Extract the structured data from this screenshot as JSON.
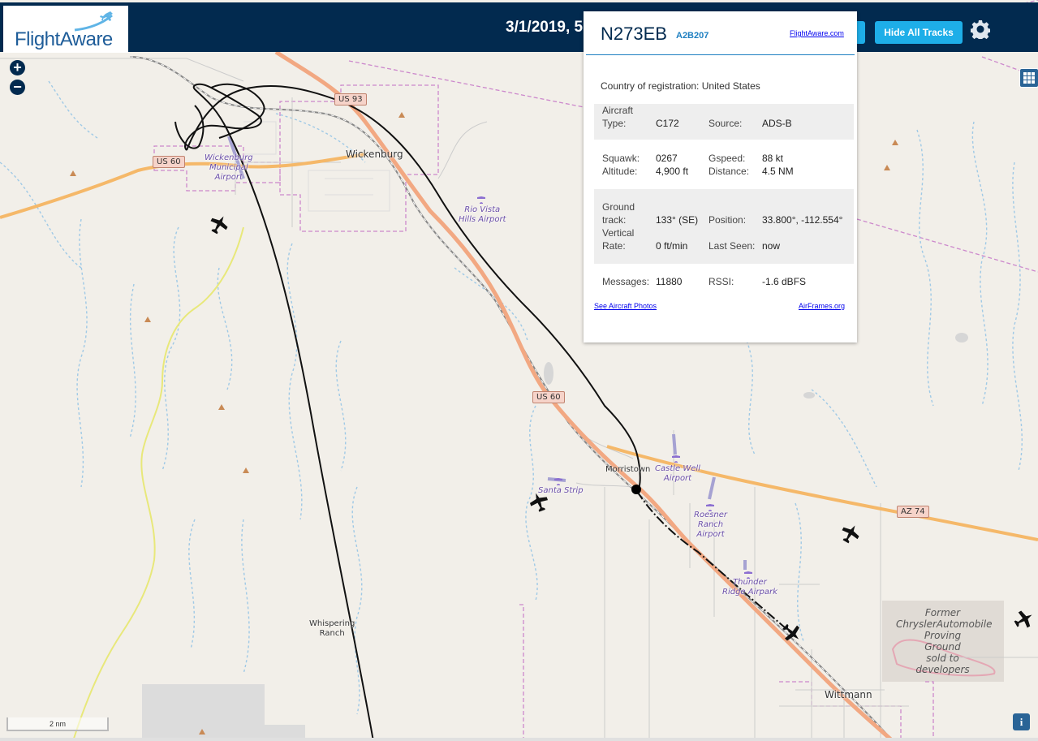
{
  "header": {
    "logo": "FlightAware",
    "title": "3/1/2019, 5",
    "hide_tracks_label": "Hide All Tracks",
    "settings_icon": "gear-icon"
  },
  "map_controls": {
    "zoom_in": "+",
    "zoom_out": "−",
    "layers_icon": "grid-icon",
    "info": "i",
    "scale": "2 nm"
  },
  "places": {
    "wickenburg": "Wickenburg",
    "morristown": "Morristown",
    "wittmann": "Wittmann",
    "whispering_ranch": [
      "Whispering",
      "Ranch"
    ]
  },
  "airports": {
    "wickenburg_municipal": [
      "Wickenburg",
      "Municipal",
      "Airport"
    ],
    "rio_vista": [
      "Rio Vista",
      "Hills Airport"
    ],
    "castle_well": [
      "Castle Well",
      "Airport"
    ],
    "santa_strip": [
      "Santa Strip"
    ],
    "roesner_ranch": [
      "Roesner",
      "Ranch",
      "Airport"
    ],
    "thunder_ridge": [
      "Thunder",
      "Ridge Airpark"
    ]
  },
  "routes": {
    "us93": "US 93",
    "us60_west": "US 60",
    "us60_south": "US 60",
    "az74": "AZ 74"
  },
  "proving_ground": [
    "Former",
    "ChryslerAutomobile",
    "Proving",
    "Ground",
    "sold to",
    "developers"
  ],
  "popup": {
    "ident": "N273EB",
    "hex": "A2B207",
    "fa_link": "FlightAware.com",
    "country_label": "Country of registration:",
    "country_value": "United States",
    "aircraft_type_label": [
      "Aircraft",
      "Type:"
    ],
    "aircraft_type_value": "C172",
    "source_label": "Source:",
    "source_value": "ADS-B",
    "squawk_label": "Squawk:",
    "squawk_value": "0267",
    "gspeed_label": "Gspeed:",
    "gspeed_value": "88 kt",
    "altitude_label": "Altitude:",
    "altitude_value": "4,900 ft",
    "distance_label": "Distance:",
    "distance_value": "4.5 NM",
    "ground_track_label": [
      "Ground",
      "track:"
    ],
    "ground_track_value": "133° (SE)",
    "position_label": "Position:",
    "position_value": "33.800°, -112.554°",
    "vertical_rate_label": [
      "Vertical",
      "Rate:"
    ],
    "vertical_rate_value": "0 ft/min",
    "last_seen_label": "Last Seen:",
    "last_seen_value": "now",
    "messages_label": "Messages:",
    "messages_value": "11880",
    "rssi_label": "RSSI:",
    "rssi_value": "-1.6 dBFS",
    "photos_link": "See Aircraft Photos",
    "airframes_link": "AirFrames.org"
  },
  "colors": {
    "header_bg": "#022a4f",
    "button_blue": "#1eaee8",
    "map_bg": "#f2efe9",
    "highway": "#f2a882",
    "state_route": "#f5b869",
    "water": "#9fc9e6",
    "boundary": "#cc88cc",
    "track": "#111111"
  }
}
